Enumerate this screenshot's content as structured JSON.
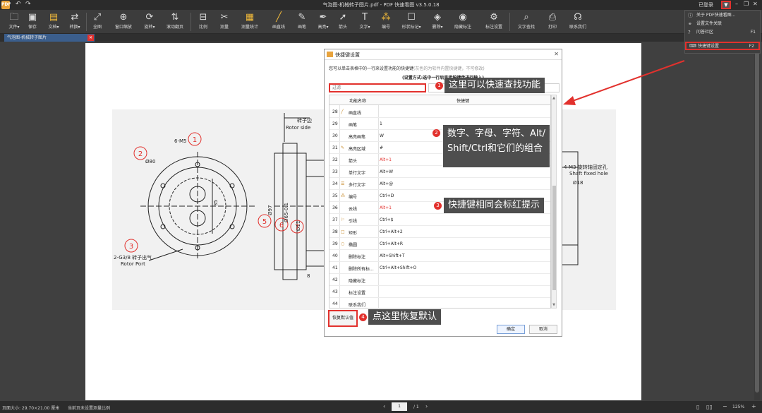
{
  "titlebar": {
    "logo": "PDF",
    "title": "气泡图-机械转子图片.pdf - PDF 快速看图 v3.5.0.18",
    "login": "已登录",
    "undo_icon": "undo-icon",
    "redo_icon": "redo-icon"
  },
  "toolbar": {
    "items": [
      {
        "label": "文件▾",
        "icon": "folder-icon"
      },
      {
        "label": "保存",
        "icon": "save-icon"
      },
      {
        "label": "文档▾",
        "icon": "document-icon"
      },
      {
        "label": "转换▾",
        "icon": "convert-icon"
      },
      {
        "label": "全图",
        "icon": "fit-page-icon"
      },
      {
        "label": "窗口缩放",
        "icon": "zoom-window-icon"
      },
      {
        "label": "旋转▾",
        "icon": "rotate-icon"
      },
      {
        "label": "滚动翻页",
        "icon": "scroll-page-icon"
      },
      {
        "label": "比例",
        "icon": "scale-icon"
      },
      {
        "label": "测量",
        "icon": "measure-icon"
      },
      {
        "label": "测量统计",
        "icon": "measure-stats-icon"
      },
      {
        "label": "画直线",
        "icon": "line-icon"
      },
      {
        "label": "画笔",
        "icon": "pen-icon"
      },
      {
        "label": "高亮▾",
        "icon": "highlight-icon"
      },
      {
        "label": "箭头",
        "icon": "arrow-icon"
      },
      {
        "label": "文字▾",
        "icon": "text-icon"
      },
      {
        "label": "编号",
        "icon": "number-icon"
      },
      {
        "label": "形状标记▾",
        "icon": "shape-icon"
      },
      {
        "label": "删除▾",
        "icon": "eraser-icon"
      },
      {
        "label": "隐藏标注",
        "icon": "eye-icon"
      },
      {
        "label": "标注设置",
        "icon": "annotation-settings-icon"
      },
      {
        "label": "文字查找",
        "icon": "search-icon"
      },
      {
        "label": "打印",
        "icon": "print-icon"
      },
      {
        "label": "联系我们",
        "icon": "headset-icon"
      }
    ]
  },
  "tab": {
    "label": "气泡图-机械转子图片"
  },
  "dropdown": {
    "items": [
      {
        "label": "关于 PDF快速看图...",
        "key": ""
      },
      {
        "label": "设置文件关联",
        "key": ""
      },
      {
        "label": "问答社区",
        "key": "F1"
      },
      {
        "label": "快捷键设置",
        "key": "F2"
      }
    ]
  },
  "dialog": {
    "title": "快捷键设置",
    "desc_main": "您可以单击表格中的一行来设置功能的快捷键",
    "desc_gray": "(灰色的为软件内置快捷键，不可修改)",
    "desc2": "(设置方式:选中一行后直接按键盘进行输入)",
    "filter_placeholder": "过滤",
    "col_name": "功能名称",
    "col_key": "快捷键",
    "rows": [
      {
        "n": "28",
        "name": "画直线",
        "key": "",
        "red": false
      },
      {
        "n": "29",
        "name": "画笔",
        "key": "1",
        "red": false
      },
      {
        "n": "30",
        "name": "高亮画笔",
        "key": "W",
        "red": false
      },
      {
        "n": "31",
        "name": "高亮区域",
        "key": "#",
        "red": false
      },
      {
        "n": "32",
        "name": "箭头",
        "key": "Alt+1",
        "red": true
      },
      {
        "n": "33",
        "name": "单行文字",
        "key": "Alt+W",
        "red": false
      },
      {
        "n": "34",
        "name": "多行文字",
        "key": "Alt+@",
        "red": false
      },
      {
        "n": "35",
        "name": "编号",
        "key": "Ctrl+D",
        "red": false
      },
      {
        "n": "36",
        "name": "云线",
        "key": "Alt+1",
        "red": true
      },
      {
        "n": "37",
        "name": "引线",
        "key": "Ctrl+$",
        "red": false
      },
      {
        "n": "38",
        "name": "矩形",
        "key": "Ctrl+Alt+2",
        "red": false
      },
      {
        "n": "39",
        "name": "椭圆",
        "key": "Ctrl+Alt+R",
        "red": false
      },
      {
        "n": "40",
        "name": "删除标注",
        "key": "Alt+Shift+T",
        "red": false
      },
      {
        "n": "41",
        "name": "删除所有标...",
        "key": "Ctrl+Alt+Shift+O",
        "red": false
      },
      {
        "n": "42",
        "name": "隐藏标注",
        "key": "",
        "red": false
      },
      {
        "n": "43",
        "name": "标注设置",
        "key": "",
        "red": false
      },
      {
        "n": "44",
        "name": "联系我们",
        "key": "",
        "red": false
      }
    ],
    "restore_label": "恢复默认值",
    "ok_label": "确定",
    "cancel_label": "取消"
  },
  "callouts": {
    "c1": {
      "num": "1",
      "text": "这里可以快速查找功能"
    },
    "c2": {
      "num": "2",
      "line1": "数字、字母、字符、Alt/",
      "line2": "Shift/Ctrl和它们的组合"
    },
    "c3": {
      "num": "3",
      "text": "快捷键相同会标红提示"
    },
    "c4": {
      "num": "4",
      "text": "点这里恢复默认"
    }
  },
  "drawing": {
    "texts": {
      "rotor_side_cn": "转子边",
      "rotor_side_en": "Rotor side",
      "m5": "6-M5",
      "d80": "Ø80",
      "g38_cn": "2-G3/8 转子出气",
      "g38_en": "Rotor Port",
      "d97": "Ø97",
      "d65": "Ø65-0.1",
      "d11": "Ø11",
      "h8": "8",
      "h35": "35",
      "shaft_cn": "4-M3 旋转轴固定孔",
      "shaft_en": "Shaft fixed hole",
      "d18": "Ø18",
      "bubble1": "1",
      "bubble2": "2",
      "bubble3": "3",
      "bubble5": "5",
      "bubble6": "6",
      "bubble7": "7"
    }
  },
  "statusbar": {
    "page_size": "页面大小: 29.70×21.00 厘米",
    "scale_info": "当前页未设置测量比例",
    "page_current": "1",
    "page_total": "/ 1",
    "zoom": "125%"
  }
}
